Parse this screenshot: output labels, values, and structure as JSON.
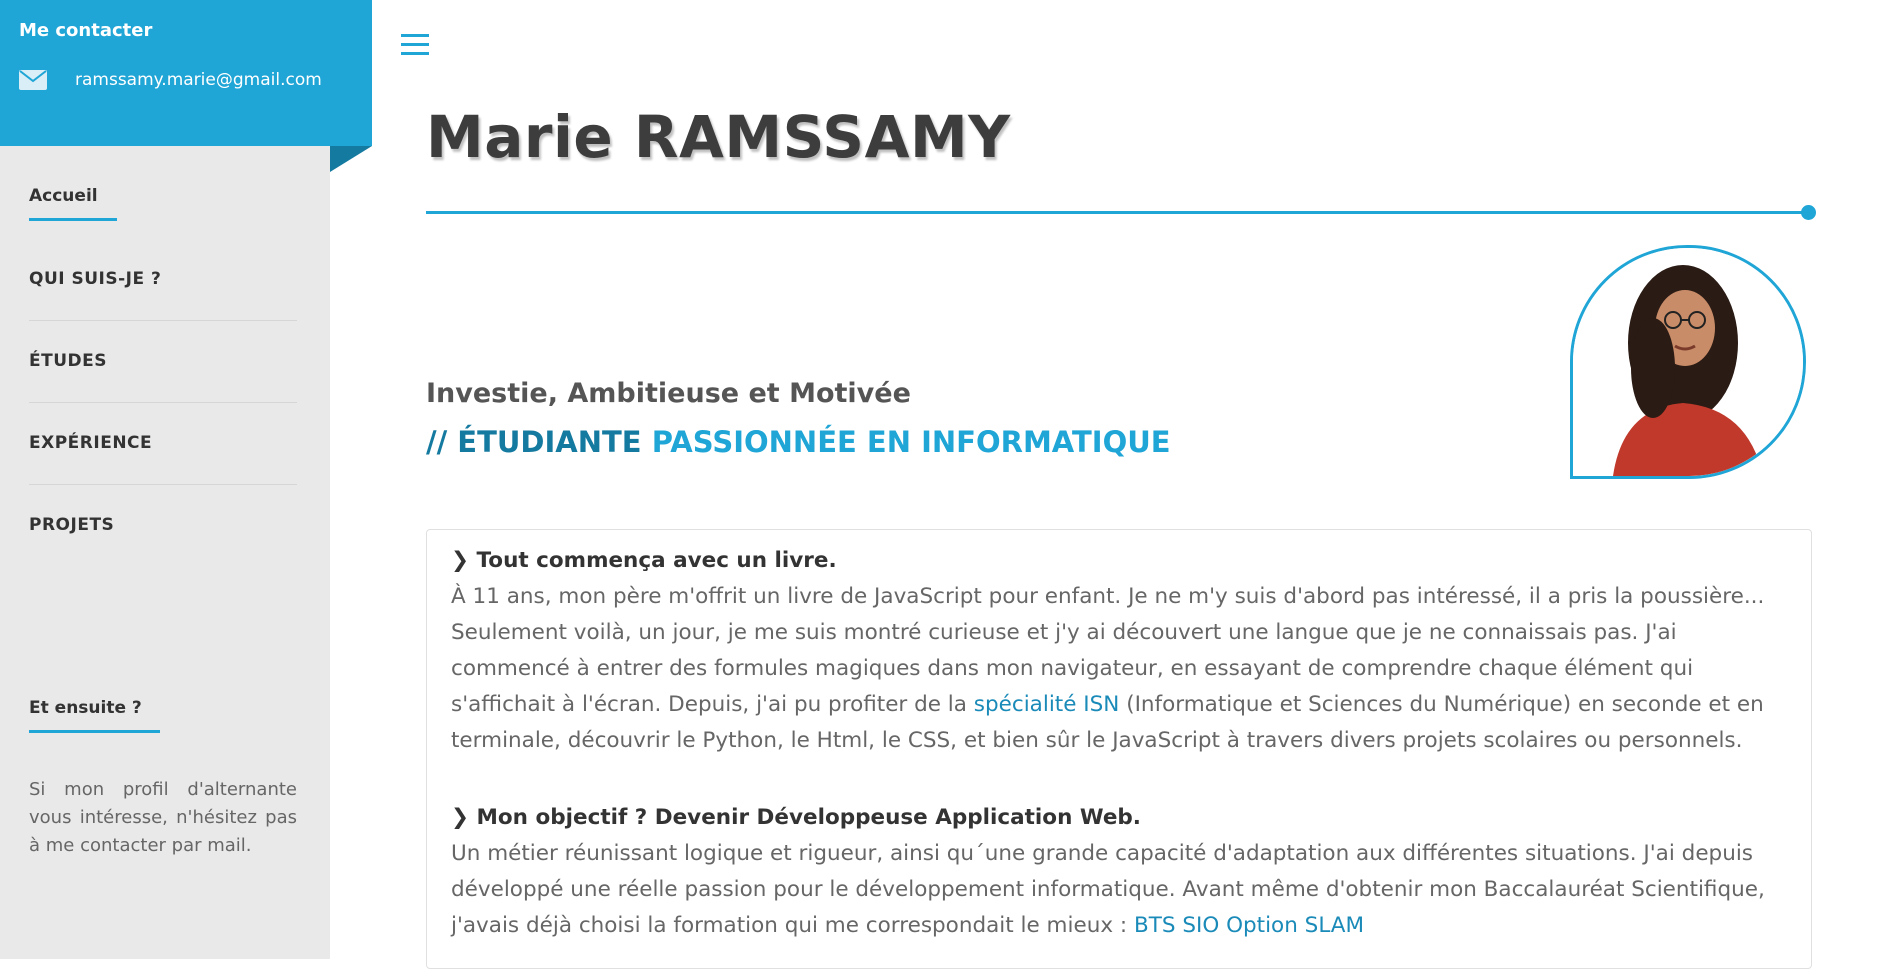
{
  "contact": {
    "title": "Me contacter",
    "email": "ramssamy.marie@gmail.com",
    "icon": "envelope-icon"
  },
  "nav": {
    "home": "Accueil",
    "items": [
      {
        "label": "QUI SUIS-JE ?"
      },
      {
        "label": "ÉTUDES"
      },
      {
        "label": "EXPÉRIENCE"
      },
      {
        "label": "PROJETS"
      }
    ]
  },
  "aside": {
    "title": "Et ensuite ?",
    "text": "Si mon profil d'alternante vous intéresse, n'hésitez pas à me contacter par mail."
  },
  "header": {
    "name": "Marie RAMSSAMY",
    "tagline": "Investie, Ambitieuse et Motivée",
    "role_prefix": "// ÉTUDIANTE",
    "role_rest": "PASSIONNÉE EN INFORMATIQUE"
  },
  "sections": [
    {
      "title": "Tout commença avec un livre.",
      "text_before_link": "À 11 ans, mon père m'offrit un livre de JavaScript pour enfant. Je ne m'y suis d'abord pas intéressé, il a pris la poussière... Seulement voilà, un jour, je me suis montré curieuse et j'y ai découvert une langue que je ne connaissais pas. J'ai commencé à entrer des formules magiques dans mon navigateur, en essayant de comprendre chaque élément qui s'affichait à l'écran. Depuis, j'ai pu profiter de la ",
      "link": "spécialité ISN",
      "text_after_link": " (Informatique et Sciences du Numérique) en seconde et en terminale, découvrir le Python, le Html, le CSS, et bien sûr le JavaScript à travers divers projets scolaires ou personnels."
    },
    {
      "title": "Mon objectif ? Devenir Développeuse Application Web.",
      "text_before_link": "Un métier réunissant logique et rigueur, ainsi qu´une grande capacité d'adaptation aux différentes situations. J'ai depuis développé une réelle passion pour le développement informatique. Avant même d'obtenir mon Baccalauréat Scientifique, j'avais déjà choisi la formation qui me correspondait le mieux : ",
      "link": "BTS SIO Option SLAM",
      "text_after_link": ""
    }
  ],
  "colors": {
    "accent": "#1fa5d6",
    "accent_dark": "#157aa0",
    "sidebar_bg": "#e9e9e9"
  }
}
